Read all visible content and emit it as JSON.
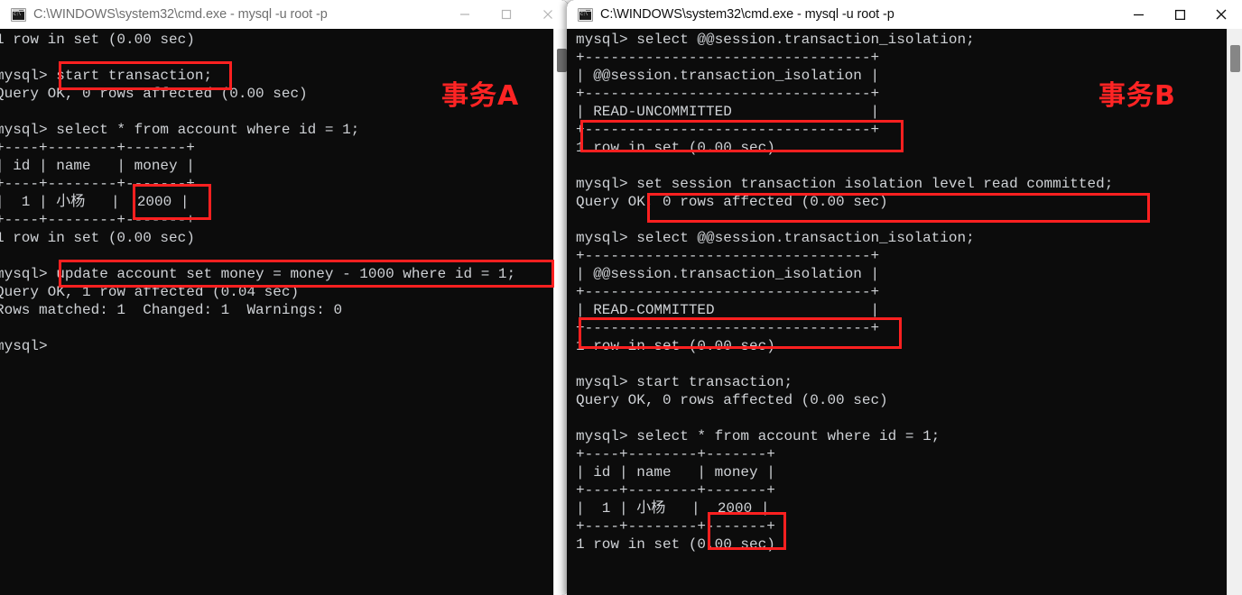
{
  "windows": {
    "left": {
      "title": "C:\\WINDOWS\\system32\\cmd.exe - mysql  -u root -p",
      "icon": "cmd-exe-icon",
      "active": false,
      "annotation": "事务A",
      "buttons": {
        "minimize": "minimize-button",
        "maximize": "maximize-button",
        "close": "close-button"
      },
      "console_lines": [
        "1 row in set (0.00 sec)",
        "",
        "mysql> start transaction;",
        "Query OK, 0 rows affected (0.00 sec)",
        "",
        "mysql> select * from account where id = 1;",
        "+----+--------+-------+",
        "| id | name   | money |",
        "+----+--------+-------+",
        "|  1 | 小杨   |  2000 |",
        "+----+--------+-------+",
        "1 row in set (0.00 sec)",
        "",
        "mysql> update account set money = money - 1000 where id = 1;",
        "Query OK, 1 row affected (0.04 sec)",
        "Rows matched: 1  Changed: 1  Warnings: 0",
        "",
        "mysql>"
      ]
    },
    "right": {
      "title": "C:\\WINDOWS\\system32\\cmd.exe - mysql  -u root -p",
      "icon": "cmd-exe-icon",
      "active": true,
      "annotation": "事务B",
      "buttons": {
        "minimize": "minimize-button",
        "maximize": "maximize-button",
        "close": "close-button"
      },
      "console_lines": [
        "mysql> select @@session.transaction_isolation;",
        "+---------------------------------+",
        "| @@session.transaction_isolation |",
        "+---------------------------------+",
        "| READ-UNCOMMITTED                |",
        "+---------------------------------+",
        "1 row in set (0.00 sec)",
        "",
        "mysql> set session transaction isolation level read committed;",
        "Query OK, 0 rows affected (0.00 sec)",
        "",
        "mysql> select @@session.transaction_isolation;",
        "+---------------------------------+",
        "| @@session.transaction_isolation |",
        "+---------------------------------+",
        "| READ-COMMITTED                  |",
        "+---------------------------------+",
        "1 row in set (0.00 sec)",
        "",
        "mysql> start transaction;",
        "Query OK, 0 rows affected (0.00 sec)",
        "",
        "mysql> select * from account where id = 1;",
        "+----+--------+-------+",
        "| id | name   | money |",
        "+----+--------+-------+",
        "|  1 | 小杨   |  2000 |",
        "+----+--------+-------+",
        "1 row in set (0.00 sec)"
      ]
    }
  },
  "highlights": {
    "accent_color": "#ff2020",
    "left": [
      {
        "name": "start-transaction-highlight",
        "label": "start transaction;"
      },
      {
        "name": "money-value-highlight",
        "label": "2000"
      },
      {
        "name": "update-statement-highlight",
        "label": "update account set money = money - 1000 where id = 1;"
      }
    ],
    "right": [
      {
        "name": "read-uncommitted-highlight",
        "label": "READ-UNCOMMITTED"
      },
      {
        "name": "set-isolation-highlight",
        "label": "set session transaction isolation level read committed;"
      },
      {
        "name": "read-committed-highlight",
        "label": "READ-COMMITTED"
      },
      {
        "name": "money-value-highlight",
        "label": "2000"
      }
    ]
  },
  "colors": {
    "console_bg": "#0c0c0c",
    "console_fg": "#cfd2d6",
    "titlebar_bg": "#ffffff",
    "highlight": "#ff2020",
    "annotation": "#ff2424"
  }
}
